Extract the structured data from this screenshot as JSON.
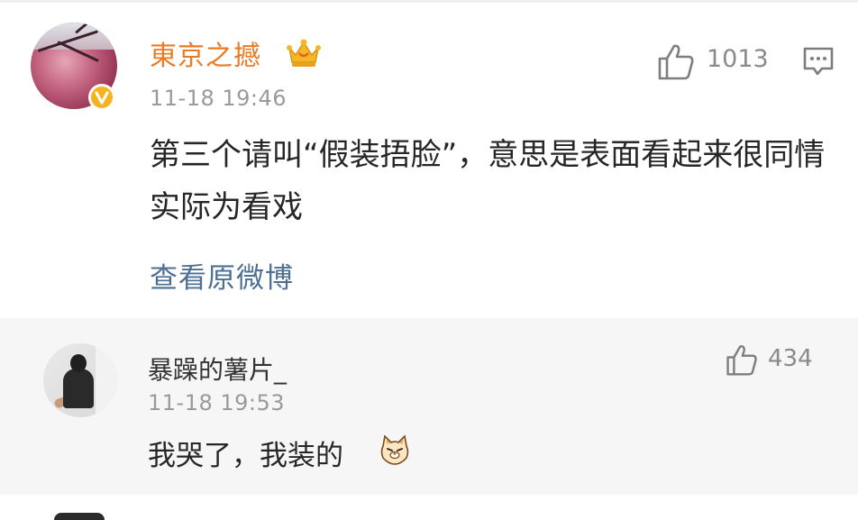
{
  "main_comment": {
    "username": "東京之撼",
    "timestamp": "11-18 19:46",
    "like_count": "1013",
    "text": "第三个请叫“假装捂脸”，意思是表面看起来很同情实际为看戏",
    "view_original_label": "查看原微博",
    "icons": {
      "badge": "crown-icon",
      "verified": "verified-badge-icon",
      "like": "thumbs-up-icon",
      "reply": "comment-icon"
    },
    "colors": {
      "username": "#ea7b24",
      "link": "#4d6f93",
      "verified": "#f5b320"
    }
  },
  "reply": {
    "username": "暴躁的薯片_",
    "timestamp": "11-18 19:53",
    "like_count": "434",
    "text": "我哭了，我装的",
    "icons": {
      "like": "thumbs-up-icon",
      "emoji": "cat-face-emoji"
    }
  }
}
